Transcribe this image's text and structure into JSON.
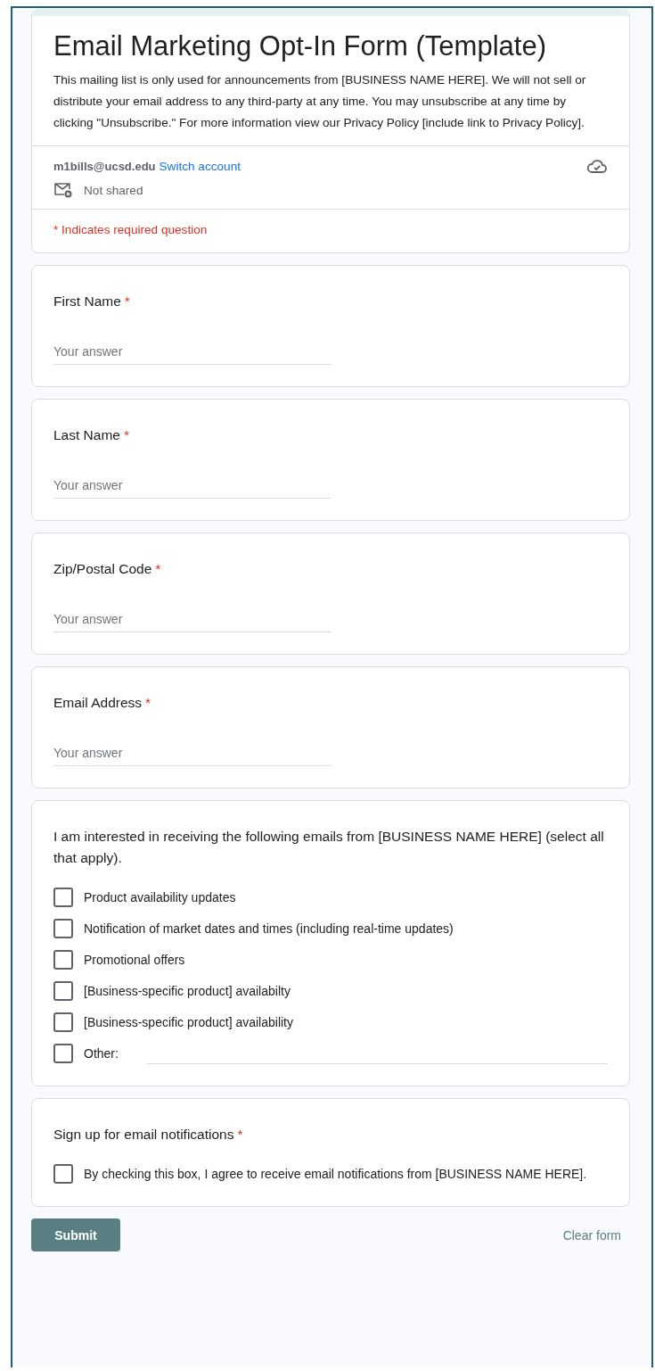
{
  "form": {
    "title": "Email Marketing Opt-In Form (Template)",
    "description": "This mailing list is only used for announcements from [BUSINESS NAME HERE]. We will not sell or distribute your email address to any third-party at any time. You may unsubscribe at any time by clicking \"Unsubscribe.\" For more information view our Privacy Policy [include link to Privacy Policy].",
    "account": {
      "email": "m1bills@ucsd.edu",
      "switch_link": "Switch account",
      "sharing": "Not shared"
    },
    "required_note": "* Indicates required question"
  },
  "questions": [
    {
      "kind": "text",
      "label": "First Name",
      "required_mark": "*",
      "placeholder": "Your answer"
    },
    {
      "kind": "text",
      "label": "Last Name",
      "required_mark": "*",
      "placeholder": "Your answer"
    },
    {
      "kind": "text",
      "label": "Zip/Postal Code",
      "required_mark": "*",
      "placeholder": "Your answer"
    },
    {
      "kind": "text",
      "label": "Email Address",
      "required_mark": "*",
      "placeholder": "Your answer"
    },
    {
      "kind": "checkboxes",
      "label": "I am interested in receiving the following emails from [BUSINESS NAME HERE] (select all that apply).",
      "options": [
        {
          "kind": "option",
          "label": "Product availability updates",
          "checked": false
        },
        {
          "kind": "option",
          "label": "Notification of market dates and times (including real-time updates)",
          "checked": false
        },
        {
          "kind": "option",
          "label": "Promotional offers",
          "checked": false
        },
        {
          "kind": "option",
          "label": "[Business-specific product] availabilty",
          "checked": false
        },
        {
          "kind": "option",
          "label": "[Business-specific product] availability",
          "checked": false
        },
        {
          "kind": "other",
          "label": "Other:",
          "checked": false
        }
      ]
    },
    {
      "kind": "checkboxes",
      "label": "Sign up for email notifications",
      "required_mark": "*",
      "options": [
        {
          "kind": "option",
          "label": "By checking this box, I agree to receive email notifications from [BUSINESS NAME HERE].",
          "checked": false
        }
      ]
    }
  ],
  "actions": {
    "submit": "Submit",
    "clear": "Clear form"
  }
}
